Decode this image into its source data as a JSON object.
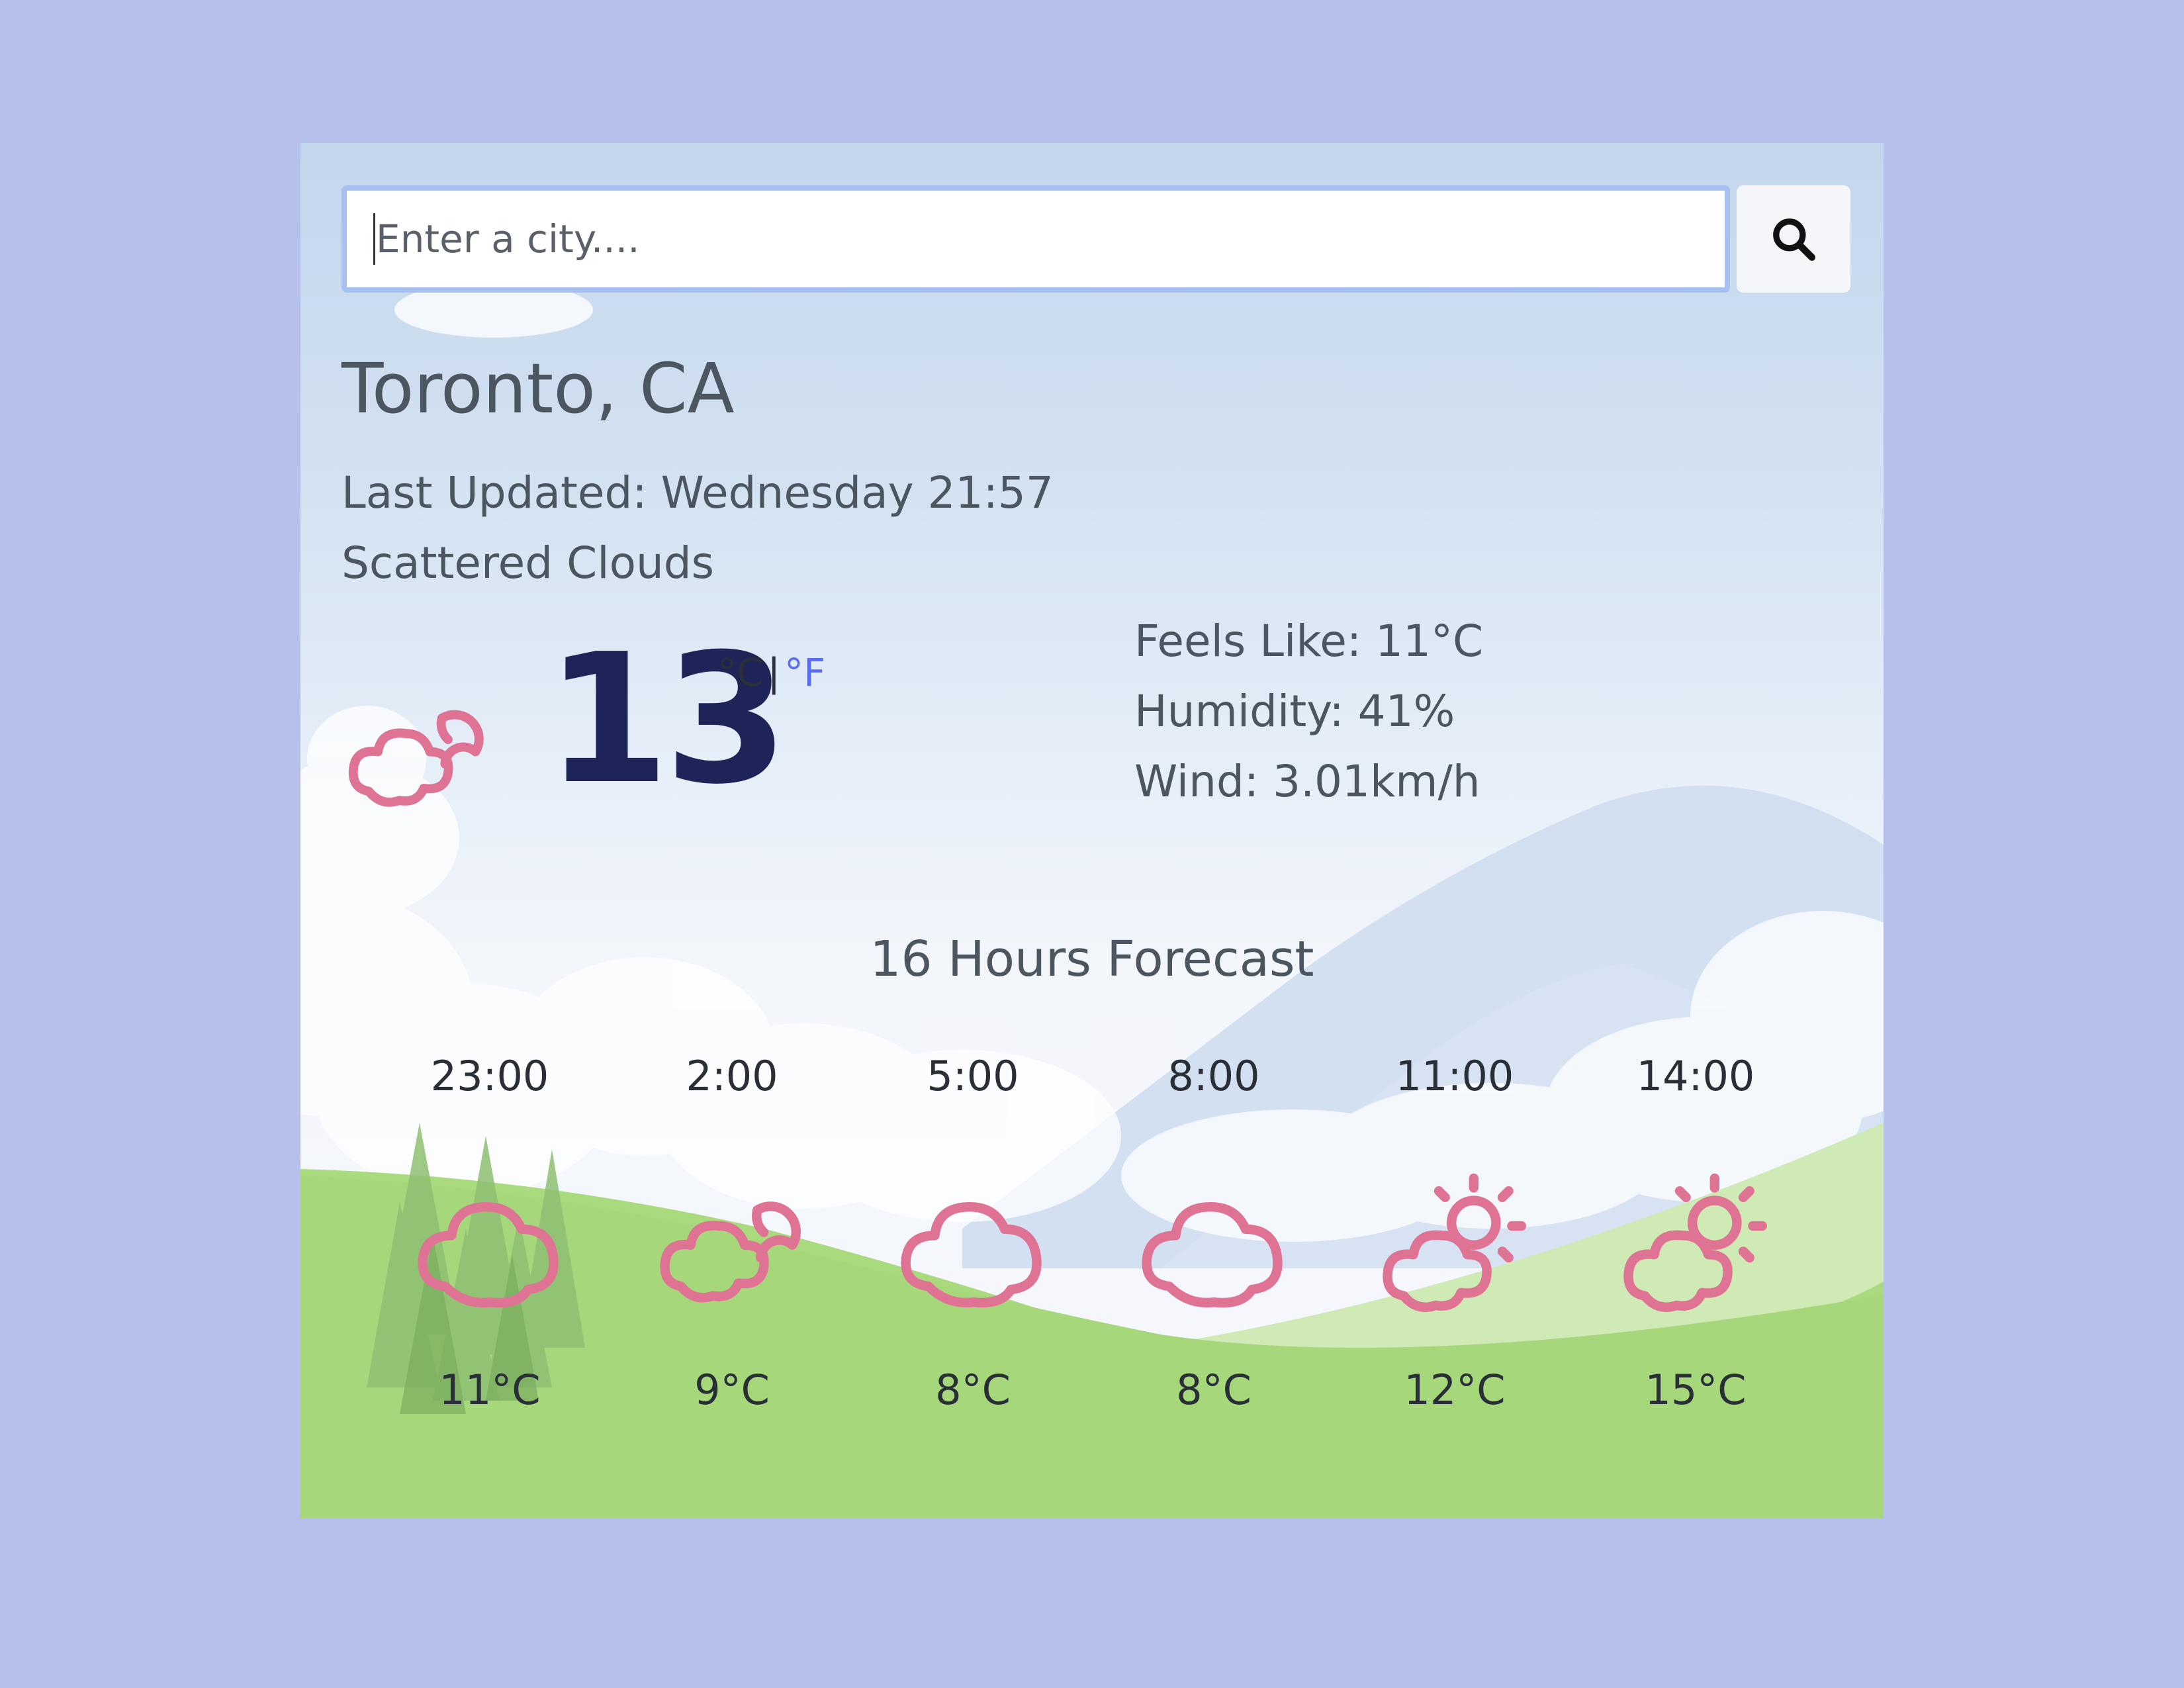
{
  "search": {
    "placeholder": "Enter a city....",
    "value": "",
    "button_icon": "search-icon"
  },
  "current": {
    "city": "Toronto, CA",
    "last_updated": "Last Updated: Wednesday 21:57",
    "description": "Scattered Clouds",
    "icon": "cloud-moon-icon",
    "temperature": "13",
    "unit_c": "°C",
    "unit_separator": "|",
    "unit_f": "°F",
    "feels_like": "Feels Like: 11°C",
    "humidity": "Humidity: 41%",
    "wind": "Wind: 3.01km/h"
  },
  "forecast": {
    "title": "16 Hours Forecast",
    "hours": [
      {
        "time": "23:00",
        "temp": "11°C",
        "icon": "cloud-icon"
      },
      {
        "time": "2:00",
        "temp": "9°C",
        "icon": "cloud-moon-icon"
      },
      {
        "time": "5:00",
        "temp": "8°C",
        "icon": "cloud-icon"
      },
      {
        "time": "8:00",
        "temp": "8°C",
        "icon": "cloud-icon"
      },
      {
        "time": "11:00",
        "temp": "12°C",
        "icon": "cloud-sun-icon"
      },
      {
        "time": "14:00",
        "temp": "15°C",
        "icon": "cloud-sun-icon"
      }
    ]
  },
  "colors": {
    "page_background": "#b7c0eb",
    "icon_stroke": "#df7394",
    "temperature_text": "#1e2458",
    "fahrenheit_link": "#5b6cf2",
    "hill_green": "#a6d97c"
  }
}
